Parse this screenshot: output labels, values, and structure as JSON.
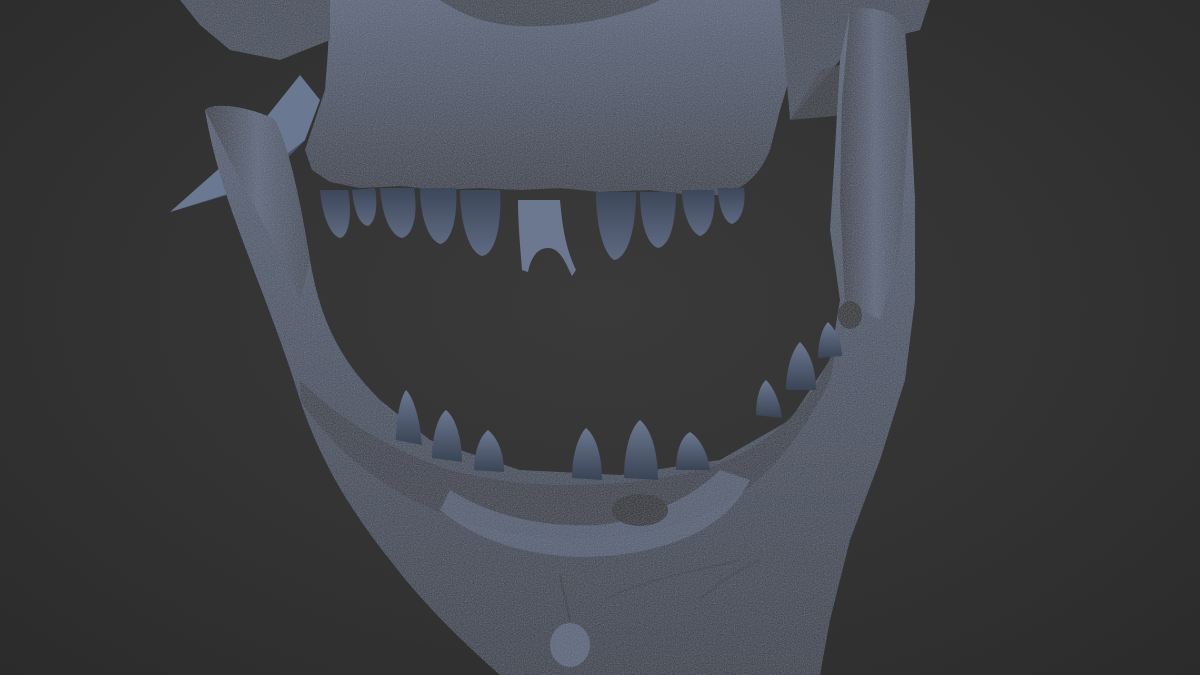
{
  "scene": {
    "subject": "skull-sculpt",
    "background_color": "#333333",
    "material_colors": {
      "bone_base": "#3f4a5e",
      "bone_light": "#6b7890",
      "bone_dark": "#1f2532",
      "cavity": "#141821"
    }
  }
}
